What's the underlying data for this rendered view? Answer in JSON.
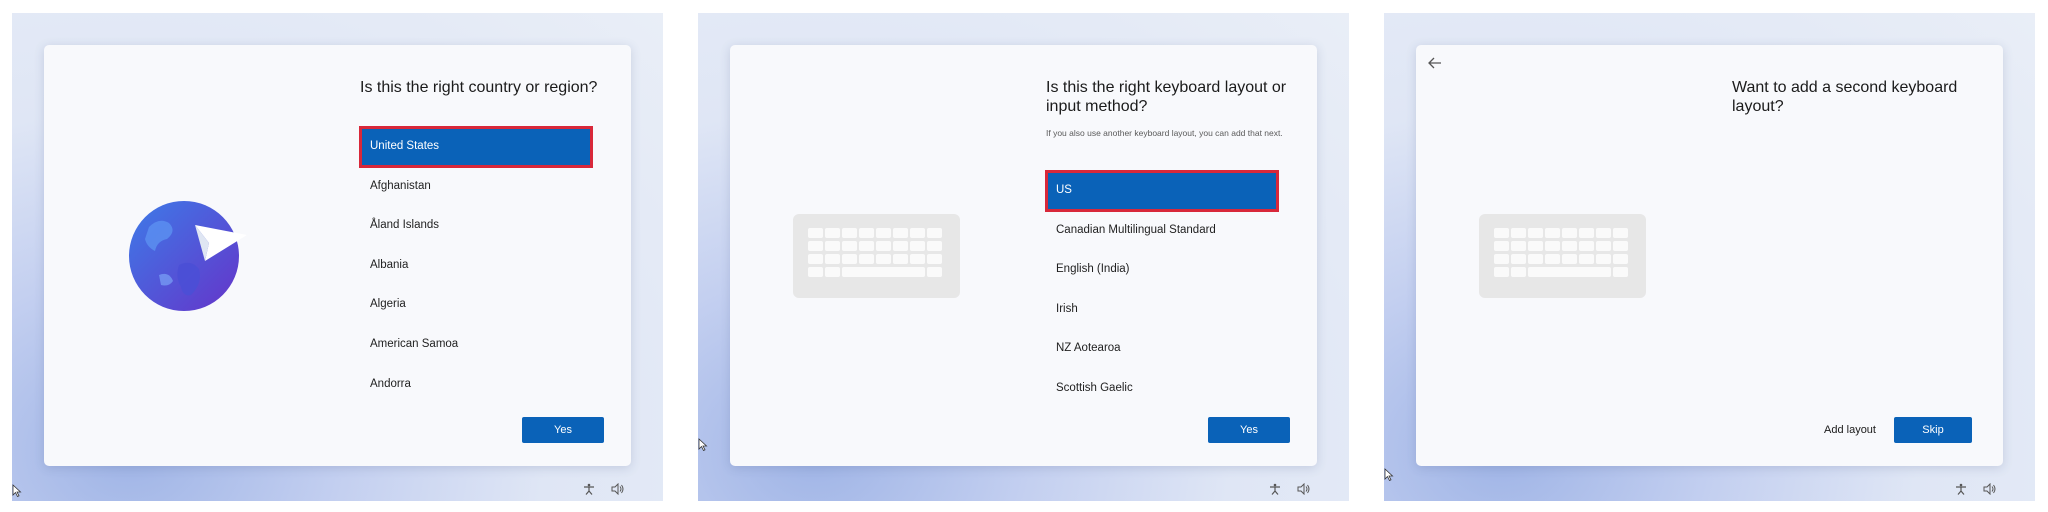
{
  "screen1": {
    "heading": "Is this the right country or region?",
    "items": [
      "United States",
      "Afghanistan",
      "Åland Islands",
      "Albania",
      "Algeria",
      "American Samoa",
      "Andorra"
    ],
    "selected_index": 0,
    "primary_label": "Yes"
  },
  "screen2": {
    "heading": "Is this the right keyboard layout or input method?",
    "subtext": "If you also use another keyboard layout, you can add that next.",
    "items": [
      "US",
      "Canadian Multilingual Standard",
      "English (India)",
      "Irish",
      "NZ Aotearoa",
      "Scottish Gaelic"
    ],
    "selected_index": 0,
    "primary_label": "Yes"
  },
  "screen3": {
    "heading": "Want to add a second keyboard layout?",
    "secondary_label": "Add layout",
    "primary_label": "Skip"
  },
  "colors": {
    "accent": "#0a62b8",
    "highlight_outline": "#d8283a"
  },
  "icons": [
    "back-arrow-icon",
    "accessibility-icon",
    "volume-icon",
    "mouse-cursor-icon",
    "globe-icon",
    "keyboard-icon"
  ]
}
